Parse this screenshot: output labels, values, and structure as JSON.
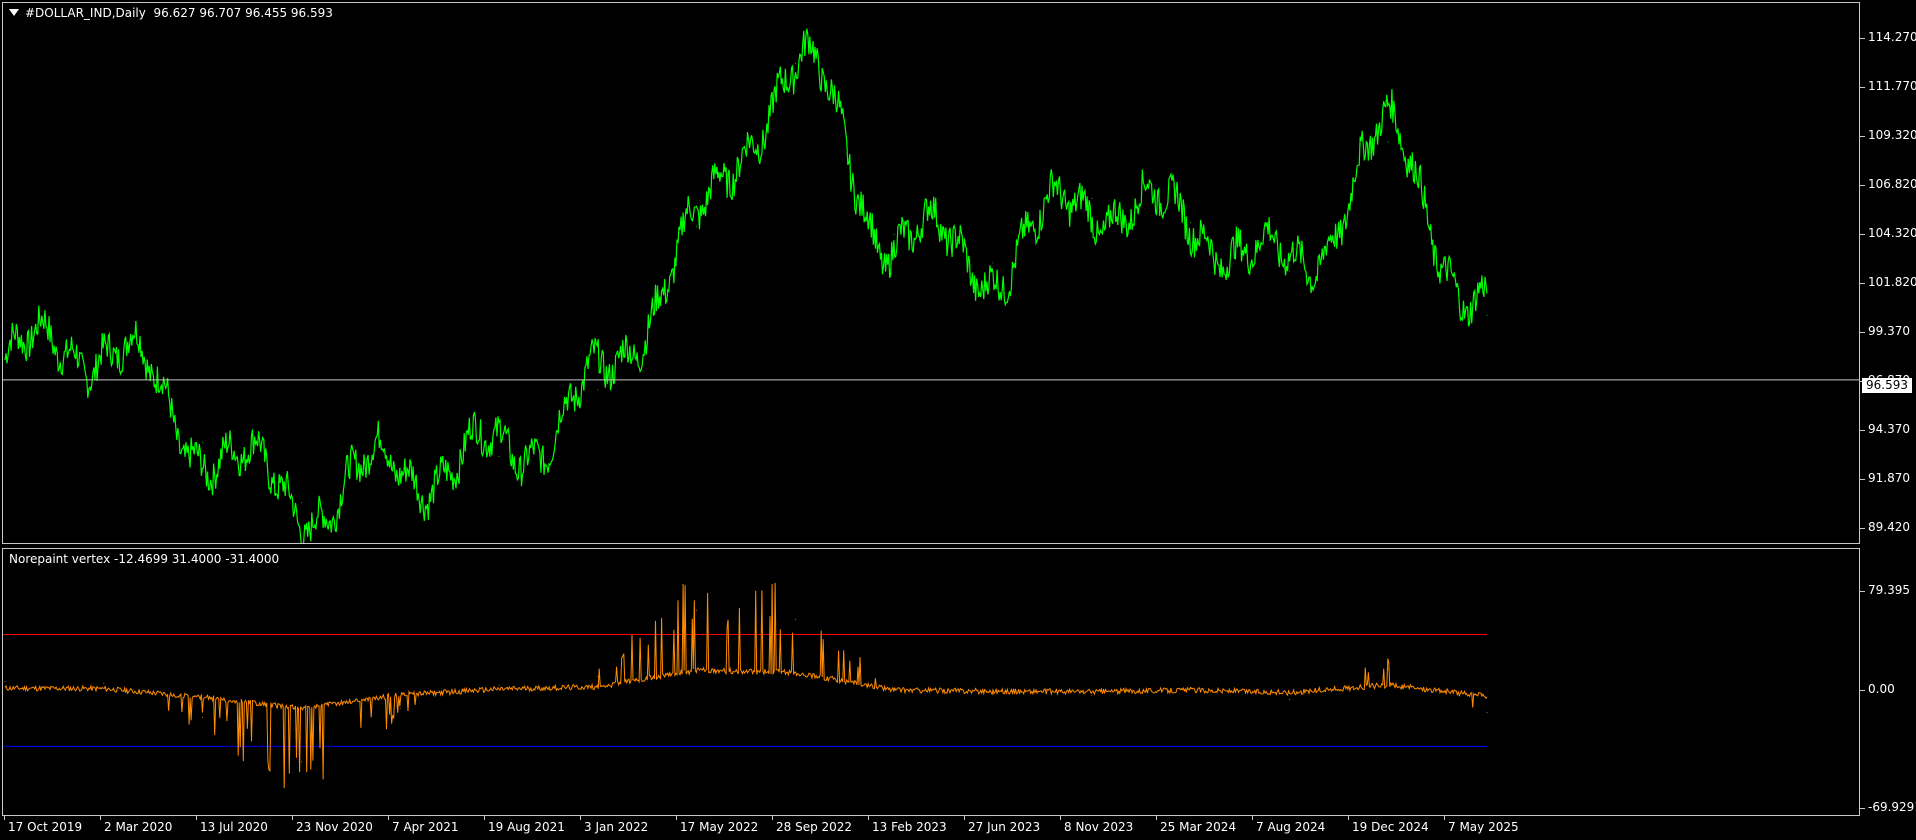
{
  "main": {
    "symbol": "#DOLLAR_IND,Daily",
    "ohlc": "96.627 96.707 96.455 96.593",
    "price_axis": [
      "114.270",
      "111.770",
      "109.320",
      "106.820",
      "104.320",
      "101.820",
      "99.370",
      "96.870",
      "94.370",
      "91.870",
      "89.420"
    ],
    "current_price": "96.593",
    "line_color": "#00ff00"
  },
  "indicator": {
    "name": "Norepaint vertex",
    "values": "-12.4699 31.4000 -31.4000",
    "axis": [
      "79.395",
      "0.00",
      "-69.9291"
    ],
    "line_color": "#ff8c00",
    "upper_level": 31.4,
    "upper_color": "#ff0000",
    "lower_level": -31.4,
    "lower_color": "#0000ff"
  },
  "time_axis": [
    "17 Oct 2019",
    "2 Mar 2020",
    "13 Jul 2020",
    "23 Nov 2020",
    "7 Apr 2021",
    "19 Aug 2021",
    "3 Jan 2022",
    "17 May 2022",
    "28 Sep 2022",
    "13 Feb 2023",
    "27 Jun 2023",
    "8 Nov 2023",
    "25 Mar 2024",
    "7 Aug 2024",
    "19 Dec 2024",
    "7 May 2025"
  ],
  "chart_data": [
    {
      "type": "line",
      "title": "#DOLLAR_IND,Daily",
      "ylim": [
        88.5,
        115.3
      ],
      "x": [
        "17 Oct 2019",
        "2 Mar 2020",
        "13 Jul 2020",
        "23 Nov 2020",
        "7 Apr 2021",
        "19 Aug 2021",
        "3 Jan 2022",
        "17 May 2022",
        "28 Sep 2022",
        "13 Feb 2023",
        "27 Jun 2023",
        "8 Nov 2023",
        "25 Mar 2024",
        "7 Aug 2024",
        "19 Dec 2024",
        "7 May 2025"
      ],
      "series": [
        {
          "values": [
            97.6,
            98.5,
            93.5,
            90.5,
            92.2,
            92.8,
            96.1,
            104.2,
            112.3,
            103.8,
            102.4,
            105.6,
            104.4,
            102.0,
            108.4,
            99.8
          ]
        }
      ]
    },
    {
      "type": "line",
      "title": "Norepaint vertex",
      "ylim": [
        -69.9291,
        79.395
      ],
      "x": [
        "17 Oct 2019",
        "2 Mar 2020",
        "13 Jul 2020",
        "23 Nov 2020",
        "7 Apr 2021",
        "19 Aug 2021",
        "3 Jan 2022",
        "17 May 2022",
        "28 Sep 2022",
        "13 Feb 2023",
        "27 Jun 2023",
        "8 Nov 2023",
        "25 Mar 2024",
        "7 Aug 2024",
        "19 Dec 2024",
        "7 May 2025"
      ],
      "series": [
        {
          "values": [
            5,
            4,
            -15,
            -40,
            -10,
            3,
            8,
            45,
            40,
            1,
            -2,
            -3,
            1,
            -5,
            12,
            -12.47
          ]
        }
      ]
    }
  ]
}
